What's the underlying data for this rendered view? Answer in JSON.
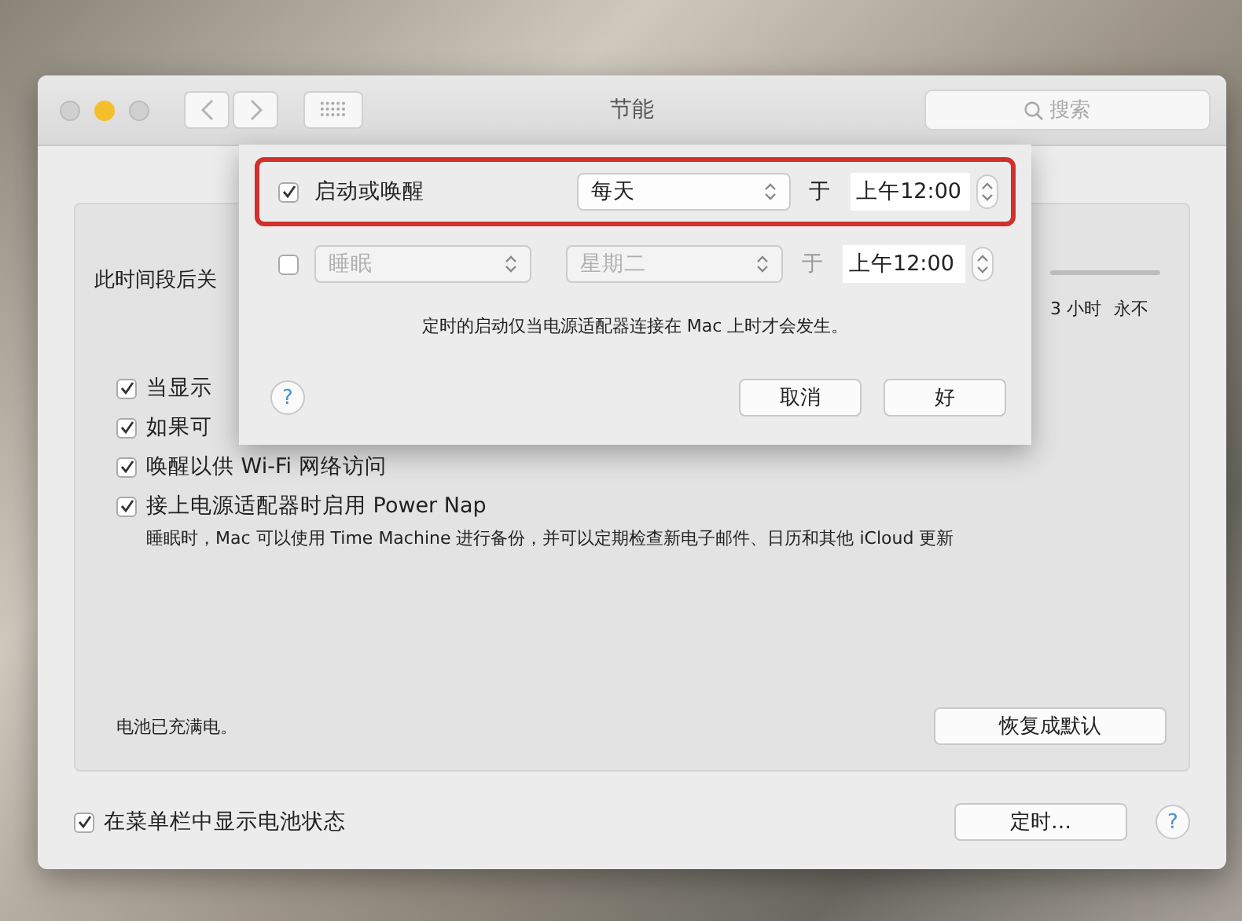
{
  "window": {
    "title": "节能",
    "search_placeholder": "搜索"
  },
  "settings": {
    "slider_label": "此时间段后关",
    "slider_ticks": [
      "3 小时",
      "永不"
    ],
    "options": [
      {
        "label": "当显示",
        "checked": true
      },
      {
        "label": "如果可",
        "checked": true
      },
      {
        "label": "唤醒以供 Wi-Fi 网络访问",
        "checked": true
      },
      {
        "label": "接上电源适配器时启用 Power Nap",
        "checked": true,
        "note": "睡眠时，Mac 可以使用 Time Machine 进行备份，并可以定期检查新电子邮件、日历和其他 iCloud 更新"
      }
    ],
    "battery_status": "电池已充满电。",
    "restore_button": "恢复成默认"
  },
  "footer": {
    "show_battery": {
      "label": "在菜单栏中显示电池状态",
      "checked": true
    },
    "schedule_button": "定时…",
    "help": "?"
  },
  "schedule_sheet": {
    "rows": [
      {
        "checked": true,
        "highlighted": true,
        "popup": false,
        "action": "启动或唤醒",
        "disabled": false,
        "day": "每天",
        "at": "于",
        "time": "上午12:00"
      },
      {
        "checked": false,
        "highlighted": false,
        "popup": true,
        "action": "睡眠",
        "disabled": true,
        "day": "星期二",
        "at": "于",
        "time": "上午12:00"
      }
    ],
    "note": "定时的启动仅当电源适配器连接在 Mac 上时才会发生。",
    "help": "?",
    "buttons": [
      {
        "label": "取消",
        "default": false
      },
      {
        "label": "好",
        "default": false
      }
    ]
  }
}
